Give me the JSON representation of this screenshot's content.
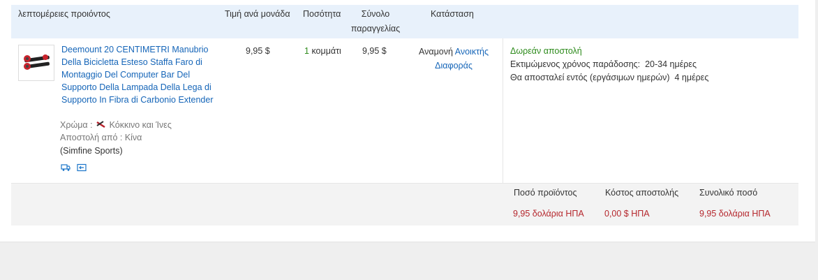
{
  "header": {
    "product_details": "λεπτομέρειες προιόντος",
    "unit_price": "Τιμή ανά μονάδα",
    "quantity": "Ποσότητα",
    "order_total_line1": "Σύνολο",
    "order_total_line2": "παραγγελίας",
    "status": "Κατάσταση"
  },
  "item": {
    "title": "Deemount 20 CENTIMETRI Manubrio Della Bicicletta Esteso Staffa Faro di Montaggio Del Computer Bar Del Supporto Della Lampada Della Lega di Supporto In Fibra di Carbonio Extender",
    "color_label": "Χρώμα :",
    "color_value": "Κόκκινο και Ίνες",
    "ships_from": "Αποστολή από : Κίνα",
    "store": "(Simfine Sports)",
    "unit_price": "9,95 $",
    "quantity_num": "1",
    "quantity_unit": "κομμάτι",
    "total": "9,95 $",
    "status_prefix": "Αναμονή",
    "status_link1": "Ανοικτής",
    "status_link2": "Διαφοράς",
    "icons": [
      "delivery-truck-icon",
      "return-icon"
    ]
  },
  "shipping": {
    "free_shipping": "Δωρεάν αποστολή",
    "estimated_label": "Εκτιμώμενος χρόνος παράδοσης:",
    "estimated_value": "20-34 ημέρες",
    "ships_within_label": "Θα αποσταλεί εντός (εργάσιμων ημερών)",
    "ships_within_value": "4 ημέρες"
  },
  "footer": {
    "product_amount_label": "Ποσό προϊόντος",
    "shipping_cost_label": "Κόστος αποστολής",
    "total_amount_label": "Συνολικό ποσό",
    "product_amount": "9,95 δολάρια ΗΠΑ",
    "shipping_cost": "0,00 $ ΗΠΑ",
    "total_amount": "9,95 δολάρια ΗΠΑ"
  },
  "colors": {
    "link": "#1565b8",
    "free_shipping": "#2c8a1a",
    "price": "#b5272d",
    "header_bg": "#e8f1fb"
  }
}
